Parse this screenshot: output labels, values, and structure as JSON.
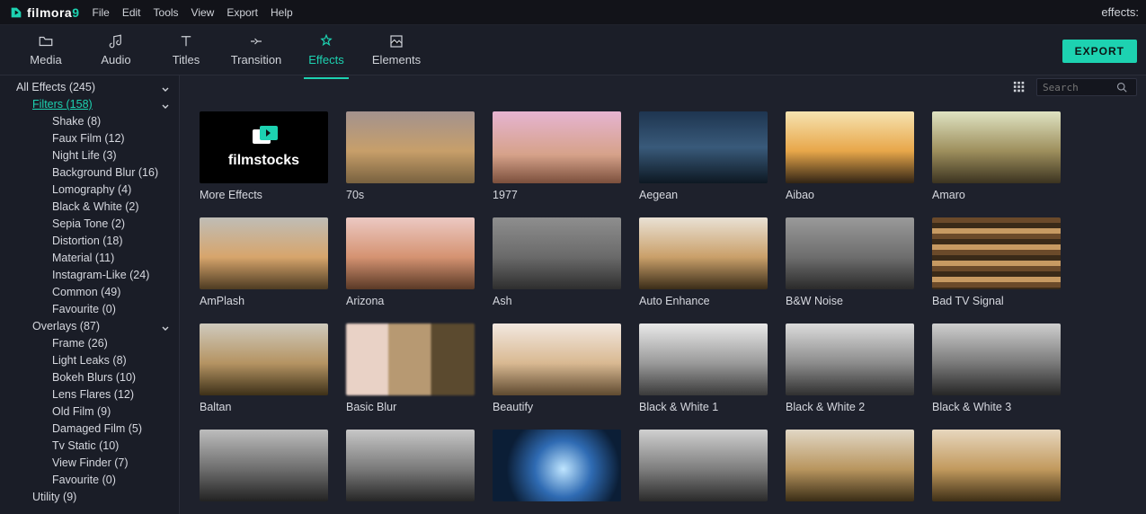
{
  "app": {
    "name": "filmora",
    "version": "9",
    "right_label": "effects:"
  },
  "menu": {
    "items": [
      "File",
      "Edit",
      "Tools",
      "View",
      "Export",
      "Help"
    ]
  },
  "tabs": {
    "items": [
      {
        "label": "Media",
        "icon": "folder-icon"
      },
      {
        "label": "Audio",
        "icon": "music-icon"
      },
      {
        "label": "Titles",
        "icon": "text-icon"
      },
      {
        "label": "Transition",
        "icon": "transition-icon"
      },
      {
        "label": "Effects",
        "icon": "effects-icon"
      },
      {
        "label": "Elements",
        "icon": "elements-icon"
      }
    ],
    "active_index": 4,
    "export_label": "EXPORT"
  },
  "sidebar": {
    "tree": [
      {
        "label": "All Effects (245)",
        "depth": 0,
        "expandable": true
      },
      {
        "label": "Filters (158)",
        "depth": 1,
        "expandable": true,
        "selected": true
      },
      {
        "label": "Shake (8)",
        "depth": 2
      },
      {
        "label": "Faux Film (12)",
        "depth": 2
      },
      {
        "label": "Night Life (3)",
        "depth": 2
      },
      {
        "label": "Background Blur (16)",
        "depth": 2
      },
      {
        "label": "Lomography (4)",
        "depth": 2
      },
      {
        "label": "Black & White (2)",
        "depth": 2
      },
      {
        "label": "Sepia Tone (2)",
        "depth": 2
      },
      {
        "label": "Distortion (18)",
        "depth": 2
      },
      {
        "label": "Material (11)",
        "depth": 2
      },
      {
        "label": "Instagram-Like (24)",
        "depth": 2
      },
      {
        "label": "Common (49)",
        "depth": 2
      },
      {
        "label": "Favourite (0)",
        "depth": 2
      },
      {
        "label": "Overlays (87)",
        "depth": 1,
        "expandable": true
      },
      {
        "label": "Frame (26)",
        "depth": 2
      },
      {
        "label": "Light Leaks (8)",
        "depth": 2
      },
      {
        "label": "Bokeh Blurs (10)",
        "depth": 2
      },
      {
        "label": "Lens Flares (12)",
        "depth": 2
      },
      {
        "label": "Old Film (9)",
        "depth": 2
      },
      {
        "label": "Damaged Film (5)",
        "depth": 2
      },
      {
        "label": "Tv Static (10)",
        "depth": 2
      },
      {
        "label": "View Finder (7)",
        "depth": 2
      },
      {
        "label": "Favourite (0)",
        "depth": 2
      },
      {
        "label": "Utility (9)",
        "depth": 1
      }
    ]
  },
  "search": {
    "placeholder": "Search"
  },
  "filmstocks": {
    "label": "filmstocks"
  },
  "grid": {
    "rows": [
      [
        {
          "title": "More Effects",
          "thumb": "filmstocks"
        },
        {
          "title": "70s",
          "thumb": "t70s"
        },
        {
          "title": "1977",
          "thumb": "t1977"
        },
        {
          "title": "Aegean",
          "thumb": "tAegean"
        },
        {
          "title": "Aibao",
          "thumb": "tAibao"
        },
        {
          "title": "Amaro",
          "thumb": "tAmaro"
        }
      ],
      [
        {
          "title": "AmPlash",
          "thumb": "tAmPlash"
        },
        {
          "title": "Arizona",
          "thumb": "tArizona"
        },
        {
          "title": "Ash",
          "thumb": "tAsh"
        },
        {
          "title": "Auto Enhance",
          "thumb": "tAuto"
        },
        {
          "title": "B&W Noise",
          "thumb": "tBWN"
        },
        {
          "title": "Bad TV Signal",
          "thumb": "tBadTV"
        }
      ],
      [
        {
          "title": "Baltan",
          "thumb": "tBaltan"
        },
        {
          "title": "Basic Blur",
          "thumb": "tBBlur"
        },
        {
          "title": "Beautify",
          "thumb": "tBeaut"
        },
        {
          "title": "Black & White 1",
          "thumb": "tBW1"
        },
        {
          "title": "Black & White 2",
          "thumb": "tBW2"
        },
        {
          "title": "Black & White 3",
          "thumb": "tBW3"
        }
      ],
      [
        {
          "title": "",
          "thumb": "tR1"
        },
        {
          "title": "",
          "thumb": "tR2"
        },
        {
          "title": "",
          "thumb": "tR3"
        },
        {
          "title": "",
          "thumb": "tR4"
        },
        {
          "title": "",
          "thumb": "tR5"
        },
        {
          "title": "",
          "thumb": "tR6"
        }
      ]
    ]
  }
}
